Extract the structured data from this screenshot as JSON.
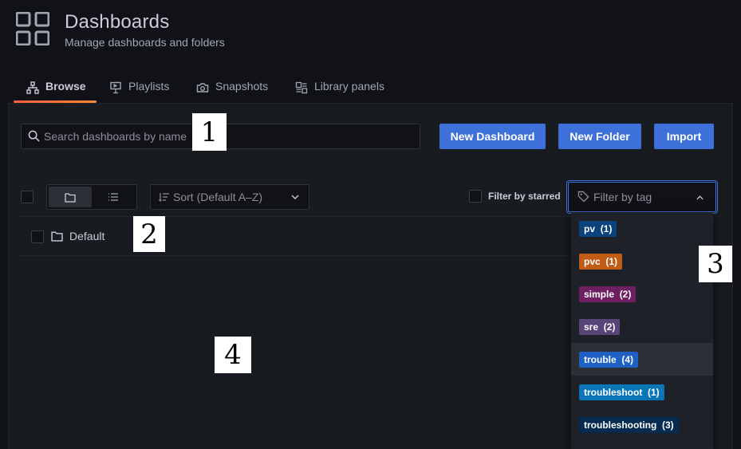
{
  "header": {
    "title": "Dashboards",
    "subtitle": "Manage dashboards and folders",
    "icon": "apps-grid-icon"
  },
  "tabs": [
    {
      "label": "Browse",
      "icon": "sitemap-icon",
      "active": true
    },
    {
      "label": "Playlists",
      "icon": "presentation-icon",
      "active": false
    },
    {
      "label": "Snapshots",
      "icon": "camera-icon",
      "active": false
    },
    {
      "label": "Library panels",
      "icon": "library-panel-icon",
      "active": false
    }
  ],
  "search": {
    "placeholder": "Search dashboards by name",
    "value": ""
  },
  "actions": {
    "new_dashboard": "New Dashboard",
    "new_folder": "New Folder",
    "import": "Import"
  },
  "toolbar": {
    "sort_label": "Sort (Default A–Z)",
    "filter_starred": "Filter by starred",
    "filter_tag_placeholder": "Filter by tag"
  },
  "folders": [
    {
      "name": "Default",
      "icon": "folder-icon"
    }
  ],
  "tag_options": [
    {
      "label": "pv",
      "count": "(1)",
      "color": "#1f60c4",
      "bg": "#0a437c"
    },
    {
      "label": "pvc",
      "count": "(1)",
      "color": "#e06a2c",
      "bg": "#c15c17"
    },
    {
      "label": "simple",
      "count": "(2)",
      "color": "#6d1f62",
      "bg": "#6d1f62"
    },
    {
      "label": "sre",
      "count": "(2)",
      "color": "#584477",
      "bg": "#584477"
    },
    {
      "label": "trouble",
      "count": "(4)",
      "color": "#1f60c4",
      "bg": "#1f60c4"
    },
    {
      "label": "troubleshoot",
      "count": "(1)",
      "color": "#0a76b8",
      "bg": "#0a76b8"
    },
    {
      "label": "troubleshooting",
      "count": "(3)",
      "color": "#052b51",
      "bg": "#052b51"
    }
  ],
  "callouts": [
    "1",
    "2",
    "3",
    "4"
  ],
  "colors": {
    "primary_button": "#3d71d9",
    "active_tab_underline": "#f55f3e",
    "background": "#111217",
    "panel": "#181b1f"
  }
}
